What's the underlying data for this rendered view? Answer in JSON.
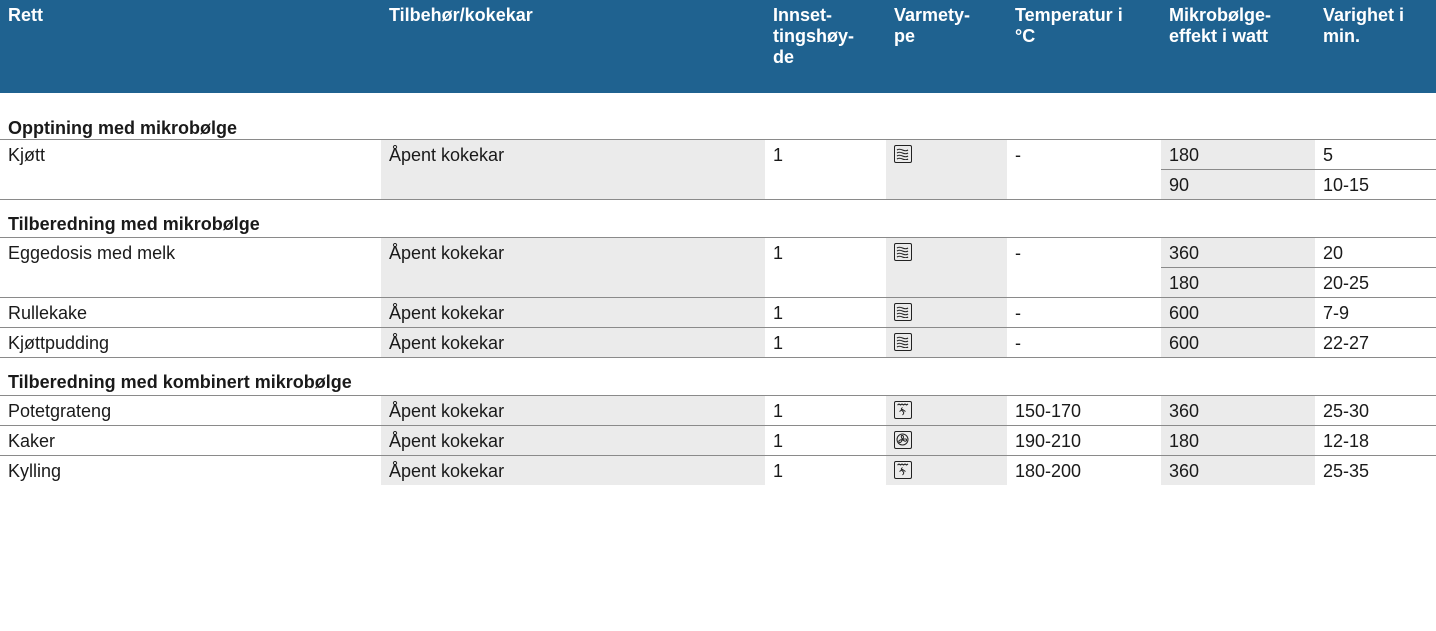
{
  "headers": {
    "rett": "Rett",
    "tilbehor": "Tilbehør/kokekar",
    "innsetting": "Innset-\ntingshøy-\nde",
    "varmetype": "Varmety-\npe",
    "temperatur": "Temperatur i\n°C",
    "mikrobolge": "Mikrobølge-\neffekt i watt",
    "varighet": "Varighet i\nmin."
  },
  "sections": [
    {
      "title": "Opptining med mikrobølge",
      "rows": [
        {
          "rett": "Kjøtt",
          "tilbehor": "Åpent kokekar",
          "hoyde": "1",
          "icon": "microwave-icon",
          "temp": "-",
          "watt": "180",
          "min": "5"
        },
        {
          "rett": "",
          "tilbehor": "",
          "hoyde": "",
          "icon": "",
          "temp": "",
          "watt": "90",
          "min": "10-15"
        }
      ]
    },
    {
      "title": "Tilberedning med mikrobølge",
      "rows": [
        {
          "rett": "Eggedosis med melk",
          "tilbehor": "Åpent kokekar",
          "hoyde": "1",
          "icon": "microwave-icon",
          "temp": "-",
          "watt": "360",
          "min": "20"
        },
        {
          "rett": "",
          "tilbehor": "",
          "hoyde": "",
          "icon": "",
          "temp": "",
          "watt": "180",
          "min": "20-25"
        },
        {
          "rett": "Rullekake",
          "tilbehor": "Åpent kokekar",
          "hoyde": "1",
          "icon": "microwave-icon",
          "temp": "-",
          "watt": "600",
          "min": "7-9"
        },
        {
          "rett": "Kjøttpudding",
          "tilbehor": "Åpent kokekar",
          "hoyde": "1",
          "icon": "microwave-icon",
          "temp": "-",
          "watt": "600",
          "min": "22-27"
        }
      ]
    },
    {
      "title": "Tilberedning med kombinert mikrobølge",
      "rows": [
        {
          "rett": "Potetgrateng",
          "tilbehor": "Åpent kokekar",
          "hoyde": "1",
          "icon": "grill-icon",
          "temp": "150-170",
          "watt": "360",
          "min": "25-30"
        },
        {
          "rett": "Kaker",
          "tilbehor": "Åpent kokekar",
          "hoyde": "1",
          "icon": "fan-icon",
          "temp": "190-210",
          "watt": "180",
          "min": "12-18"
        },
        {
          "rett": "Kylling",
          "tilbehor": "Åpent kokekar",
          "hoyde": "1",
          "icon": "grill-icon",
          "temp": "180-200",
          "watt": "360",
          "min": "25-35"
        }
      ]
    }
  ]
}
